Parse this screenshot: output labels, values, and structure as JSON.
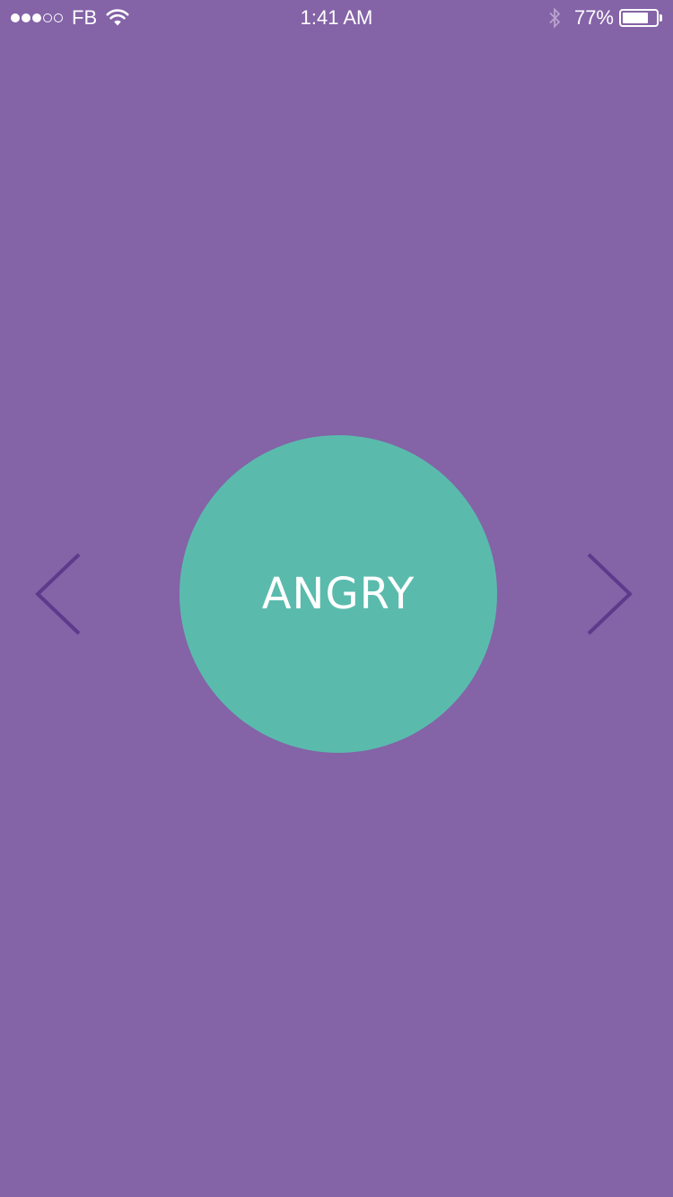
{
  "status_bar": {
    "carrier": "FB",
    "signal_bars_filled": 3,
    "signal_bars_total": 5,
    "time": "1:41 AM",
    "battery_percent": "77%",
    "battery_level": 0.77,
    "icons": [
      "signal-dots",
      "wifi-icon",
      "bluetooth-icon",
      "battery-icon"
    ]
  },
  "mood": {
    "current_label": "ANGRY"
  },
  "navigation": {
    "prev_icon": "chevron-left-icon",
    "next_icon": "chevron-right-icon"
  },
  "colors": {
    "background": "#8463a7",
    "circle": "#5abbad",
    "arrow": "#5e3a8c",
    "text": "#ffffff",
    "bluetooth_icon": "#b8a3cf"
  }
}
